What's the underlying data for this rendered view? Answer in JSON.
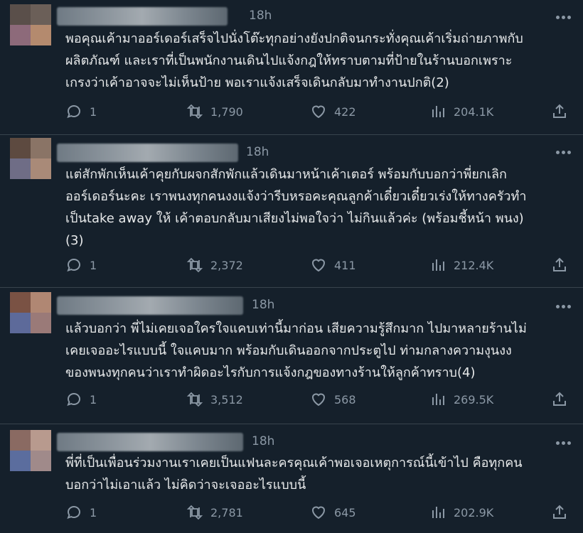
{
  "tweets": [
    {
      "time": "18h",
      "avatar_colors": [
        "#5a4f4a",
        "#6b5f58",
        "#8d6a7a",
        "#b48a6e"
      ],
      "text": "พอคุณเค้ามาออร์เดอร์เสร็จไปนั่งโต๊ะทุกอย่างยังปกติจนกระทั่งคุณเค้าเริ่มถ่ายภาพกับ\nผลิตภัณฑ์ และเราที่เป็นพนักงานเดินไปแจ้งกฎให้ทราบตามที่ป้ายในร้านบอกเพราะ\nเกรงว่าเค้าอาจจะไม่เห็นป้าย พอเราแจ้งเสร็จเดินกลับมาทำงานปกติ(2)",
      "replies": "1",
      "retweets": "1,790",
      "likes": "422",
      "views": "204.1K"
    },
    {
      "time": "18h",
      "avatar_colors": [
        "#5d4a40",
        "#8a7466",
        "#6f6d86",
        "#a98a78"
      ],
      "text": "แต่สักพักเห็นเค้าคุยกับผจกสักพักแล้วเดินมาหน้าเค้าเตอร์ พร้อมกับบอกว่าพี่ยกเลิก\nออร์เดอร์นะคะ เราพนงทุกคนงงแจ้งว่ารีบหรอคะคุณลูกค้าเดี๋ยวเดี๋ยวเร่งให้ทางครัวทำ\nเป็นtake away ให้ เค้าตอบกลับมาเสียงไม่พอใจว่า ไม่กินแล้วค่ะ (พร้อมชี้หน้า พนง)\n(3)",
      "replies": "1",
      "retweets": "2,372",
      "likes": "411",
      "views": "212.4K"
    },
    {
      "time": "18h",
      "avatar_colors": [
        "#7a5244",
        "#b08773",
        "#5d6a9a",
        "#9a7a78"
      ],
      "text": "แล้วบอกว่า พี่ไม่เคยเจอใครใจแคบเท่านี้มาก่อน เสียความรู้สึกมาก ไปมาหลายร้านไม่\nเคยเจออะไรแบบนี้ ใจแคบมาก พร้อมกับเดินออกจากประตูไป ท่ามกลางความงุนงง\nของพนงทุกคนว่าเราทำผิดอะไรกับการแจ้งกฎของทางร้านให้ลูกค้าทราบ(4)",
      "replies": "1",
      "retweets": "3,512",
      "likes": "568",
      "views": "269.5K"
    },
    {
      "time": "18h",
      "avatar_colors": [
        "#8a6a62",
        "#b89a8e",
        "#5b6d9e",
        "#a08a8a"
      ],
      "text": "พี่ที่เป็นเพื่อนร่วมงานเราเคยเป็นแฟนละครคุณเค้าพอเจอเหตุการณ์นี้เข้าไป คือทุกคน\nบอกว่าไม่เอาแล้ว ไม่คิดว่าจะเจออะไรแบบนี้",
      "replies": "1",
      "retweets": "2,781",
      "likes": "645",
      "views": "202.9K"
    }
  ],
  "icons": [
    "reply-icon",
    "retweet-icon",
    "like-icon",
    "views-icon",
    "share-icon",
    "more-icon"
  ]
}
